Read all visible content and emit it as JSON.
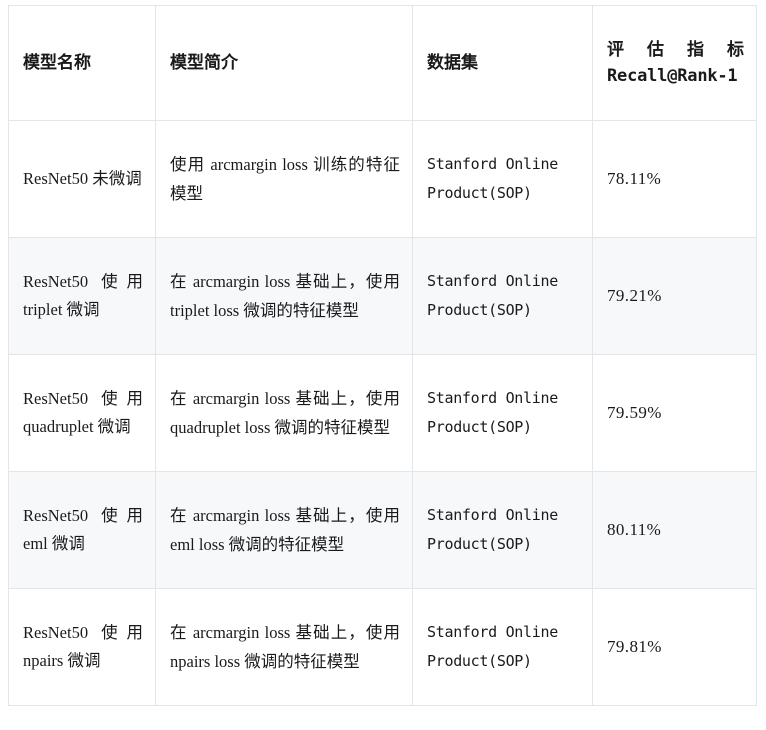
{
  "table": {
    "columns": [
      {
        "key": "model_name",
        "label": "模型名称"
      },
      {
        "key": "model_intro",
        "label": "模型简介"
      },
      {
        "key": "dataset",
        "label": "数据集"
      },
      {
        "key": "metric",
        "label": "评估指标",
        "label_sub": "Recall@Rank-1"
      }
    ],
    "rows": [
      {
        "model_name": "ResNet50 未微调",
        "model_intro": "使用 arcmargin loss 训练的特征模型",
        "dataset": "Stanford Online Product(SOP)",
        "metric": "78.11%"
      },
      {
        "model_name": "ResNet50 使用 triplet 微调",
        "model_intro": "在 arcmargin loss 基础上，使用 triplet loss 微调的特征模型",
        "dataset": "Stanford Online Product(SOP)",
        "metric": "79.21%"
      },
      {
        "model_name": "ResNet50 使用 quadruplet 微调",
        "model_intro": "在 arcmargin loss 基础上，使用 quadruplet loss 微调的特征模型",
        "dataset": "Stanford Online Product(SOP)",
        "metric": "79.59%"
      },
      {
        "model_name": "ResNet50 使用 eml 微调",
        "model_intro": "在 arcmargin loss 基础上，使用 eml loss 微调的特征模型",
        "dataset": "Stanford Online Product(SOP)",
        "metric": "80.11%"
      },
      {
        "model_name": "ResNet50 使用 npairs 微调",
        "model_intro": "在 arcmargin loss 基础上，使用 npairs loss 微调的特征模型",
        "dataset": "Stanford Online Product(SOP)",
        "metric": "79.81%"
      }
    ],
    "style": {
      "border_color": "#e3e5e8",
      "stripe_color": "#f7f8fa",
      "text_color": "#1a1a1a",
      "background": "#ffffff"
    }
  }
}
